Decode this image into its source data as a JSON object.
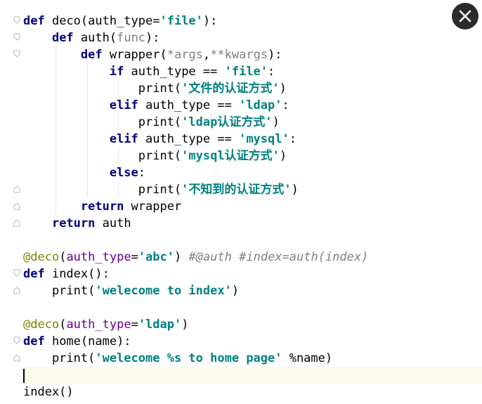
{
  "editor": {
    "close_icon": "close-icon",
    "fold_icon": "fold-marker-icon",
    "colors": {
      "keyword": "#000080",
      "string": "#008080",
      "decorator": "#808000",
      "keyword_arg": "#660099",
      "comment": "#808080",
      "parameter": "#808080",
      "current_line": "#fcfaed"
    },
    "lines": [
      [
        {
          "t": "def",
          "c": "kw"
        },
        {
          "t": " deco(auth_type="
        },
        {
          "t": "'file'",
          "c": "str"
        },
        {
          "t": "):"
        }
      ],
      [
        {
          "t": "    "
        },
        {
          "t": "def",
          "c": "kw"
        },
        {
          "t": " auth("
        },
        {
          "t": "func",
          "c": "param"
        },
        {
          "t": "):"
        }
      ],
      [
        {
          "t": "        "
        },
        {
          "t": "def",
          "c": "kw"
        },
        {
          "t": " wrapper("
        },
        {
          "t": "*args",
          "c": "param"
        },
        {
          "t": ","
        },
        {
          "t": "**kwargs",
          "c": "param"
        },
        {
          "t": "):"
        }
      ],
      [
        {
          "t": "            "
        },
        {
          "t": "if",
          "c": "kw"
        },
        {
          "t": " auth_type == "
        },
        {
          "t": "'file'",
          "c": "str"
        },
        {
          "t": ":"
        }
      ],
      [
        {
          "t": "                print("
        },
        {
          "t": "'文件的认证方式'",
          "c": "str"
        },
        {
          "t": ")"
        }
      ],
      [
        {
          "t": "            "
        },
        {
          "t": "elif",
          "c": "kw"
        },
        {
          "t": " auth_type == "
        },
        {
          "t": "'ldap'",
          "c": "str"
        },
        {
          "t": ":"
        }
      ],
      [
        {
          "t": "                print("
        },
        {
          "t": "'ldap认证方式'",
          "c": "str"
        },
        {
          "t": ")"
        }
      ],
      [
        {
          "t": "            "
        },
        {
          "t": "elif",
          "c": "kw"
        },
        {
          "t": " auth_type == "
        },
        {
          "t": "'mysql'",
          "c": "str"
        },
        {
          "t": ":"
        }
      ],
      [
        {
          "t": "                print("
        },
        {
          "t": "'mysql认证方式'",
          "c": "str"
        },
        {
          "t": ")"
        }
      ],
      [
        {
          "t": "            "
        },
        {
          "t": "else",
          "c": "kw"
        },
        {
          "t": ":"
        }
      ],
      [
        {
          "t": "                print("
        },
        {
          "t": "'不知到的认证方式'",
          "c": "str"
        },
        {
          "t": ")"
        }
      ],
      [
        {
          "t": "        "
        },
        {
          "t": "return",
          "c": "kw"
        },
        {
          "t": " wrapper"
        }
      ],
      [
        {
          "t": "    "
        },
        {
          "t": "return",
          "c": "kw"
        },
        {
          "t": " auth"
        }
      ],
      [],
      [
        {
          "t": "@deco",
          "c": "deco"
        },
        {
          "t": "("
        },
        {
          "t": "auth_type",
          "c": "kwarg"
        },
        {
          "t": "="
        },
        {
          "t": "'abc'",
          "c": "str"
        },
        {
          "t": ") "
        },
        {
          "t": "#@auth #index=auth(index)",
          "c": "cmt"
        }
      ],
      [
        {
          "t": "def",
          "c": "kw"
        },
        {
          "t": " index():"
        }
      ],
      [
        {
          "t": "    print("
        },
        {
          "t": "'welecome to index'",
          "c": "str"
        },
        {
          "t": ")"
        }
      ],
      [],
      [
        {
          "t": "@deco",
          "c": "deco"
        },
        {
          "t": "("
        },
        {
          "t": "auth_type",
          "c": "kwarg"
        },
        {
          "t": "="
        },
        {
          "t": "'ldap'",
          "c": "str"
        },
        {
          "t": ")"
        }
      ],
      [
        {
          "t": "def",
          "c": "kw"
        },
        {
          "t": " home(name):"
        }
      ],
      [
        {
          "t": "    print("
        },
        {
          "t": "'welecome %s to home page'",
          "c": "str"
        },
        {
          "t": " %name)"
        }
      ],
      [],
      [
        {
          "t": "index()"
        }
      ]
    ]
  }
}
